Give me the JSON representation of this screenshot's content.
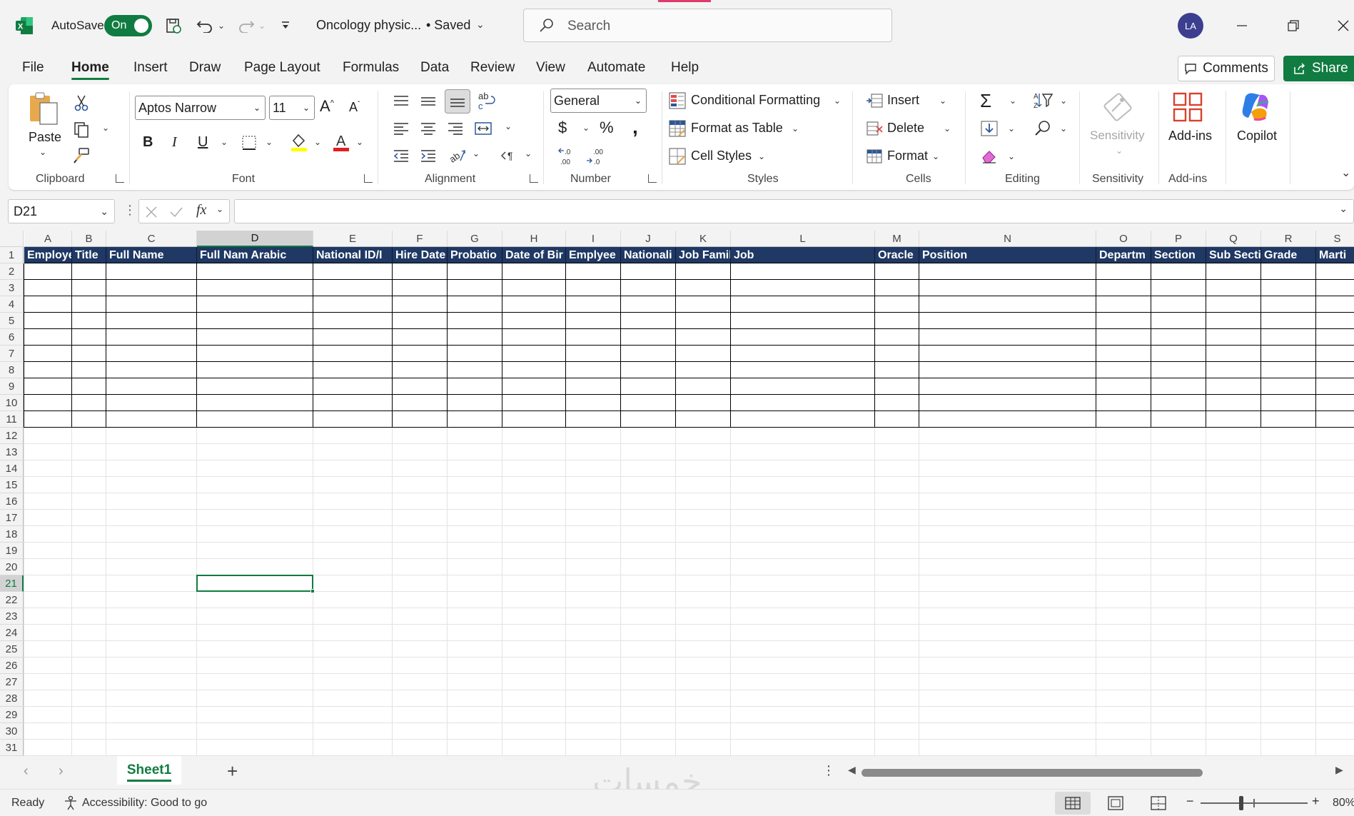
{
  "titlebar": {
    "autosave_label": "AutoSave",
    "autosave_state": "On",
    "file_name": "Oncology physic...",
    "save_status": "• Saved",
    "search_placeholder": "Search",
    "avatar_initials": "LA"
  },
  "menu": {
    "tabs": [
      "File",
      "Home",
      "Insert",
      "Draw",
      "Page Layout",
      "Formulas",
      "Data",
      "Review",
      "View",
      "Automate",
      "Help"
    ],
    "active": "Home",
    "comments_label": "Comments",
    "share_label": "Share"
  },
  "ribbon": {
    "clipboard": {
      "label": "Clipboard",
      "paste": "Paste"
    },
    "font": {
      "label": "Font",
      "font_name": "Aptos Narrow",
      "font_size": "11",
      "bold": "B",
      "italic": "I",
      "underline": "U"
    },
    "alignment": {
      "label": "Alignment"
    },
    "number": {
      "label": "Number",
      "format": "General"
    },
    "styles": {
      "label": "Styles",
      "conditional": "Conditional Formatting",
      "format_table": "Format as Table",
      "cell_styles": "Cell Styles"
    },
    "cells": {
      "label": "Cells",
      "insert": "Insert",
      "delete": "Delete",
      "format": "Format"
    },
    "editing": {
      "label": "Editing"
    },
    "sensitivity": {
      "label": "Sensitivity",
      "button": "Sensitivity"
    },
    "addins": {
      "label": "Add-ins",
      "button": "Add-ins"
    },
    "copilot": {
      "button": "Copilot"
    }
  },
  "formula_bar": {
    "name_box": "D21",
    "formula": ""
  },
  "sheet": {
    "columns": [
      "A",
      "B",
      "C",
      "D",
      "E",
      "F",
      "G",
      "H",
      "I",
      "J",
      "K",
      "L",
      "M",
      "N",
      "O",
      "P",
      "Q",
      "R",
      "S"
    ],
    "selected_column": "D",
    "row_numbers": [
      "1",
      "2",
      "3",
      "4",
      "5",
      "6",
      "7",
      "8",
      "9",
      "10",
      "11",
      "12",
      "13",
      "14",
      "15",
      "16",
      "17",
      "18",
      "19",
      "20",
      "21",
      "22",
      "23",
      "24",
      "25",
      "26",
      "27",
      "28",
      "29",
      "30",
      "31"
    ],
    "selected_row": "21",
    "header_row": [
      "Employe",
      "Title",
      "Full Name",
      "Full Nam Arabic",
      "National ID/I",
      "Hire Date",
      "Probatio",
      "Date of Bir",
      "Emplyee",
      "Nationali",
      "Job Famil",
      "Job",
      "Oracle",
      "Position",
      "Departm",
      "Section",
      "Sub Secti",
      "Grade",
      "Marti"
    ],
    "header_fill": "#1f3864",
    "selected_cell": "D21"
  },
  "sheet_tabs": {
    "active": "Sheet1",
    "watermark": "خمسات"
  },
  "statusbar": {
    "ready": "Ready",
    "accessibility": "Accessibility: Good to go",
    "zoom": "80%"
  }
}
